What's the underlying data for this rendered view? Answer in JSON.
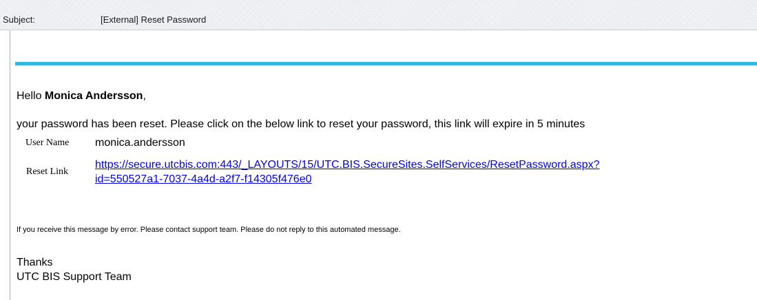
{
  "header": {
    "subject_label": "Subject:",
    "subject_value": "[External] Reset Password"
  },
  "email": {
    "greeting_prefix": "Hello ",
    "recipient_name": "Monica Andersson",
    "greeting_suffix": ",",
    "intro": "your password has been reset. Please click on the below link to reset your password, this link will expire in 5 minutes",
    "user_name_label": "User Name",
    "user_name_value": "monica.andersson",
    "reset_link_label": "Reset Link",
    "reset_link_line1": "https://secure.utcbis.com:443/_LAYOUTS/15/UTC.BIS.SecureSites.SelfServices/ResetPassword.aspx?",
    "reset_link_line2": "id=550527a1-7037-4a4d-a2f7-f14305f476e0",
    "disclaimer": "If you receive this message by error. Please contact support team. Please do not reply to this automated message.",
    "thanks": "Thanks",
    "signature": "UTC BIS Support Team"
  },
  "colors": {
    "accent_rule": "#33b7e3",
    "link": "#0000ee",
    "header_bg": "#eef0f3"
  }
}
